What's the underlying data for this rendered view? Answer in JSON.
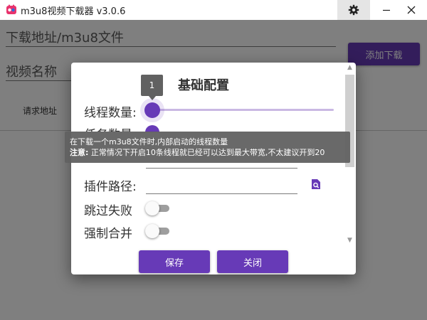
{
  "window": {
    "title": "m3u8视频下载器 v3.0.6",
    "icons": {
      "app": "app-logo-icon",
      "settings": "gear-icon",
      "minimize": "minimize-icon",
      "close": "close-icon"
    }
  },
  "main": {
    "url_placeholder": "下载地址/m3u8文件",
    "name_placeholder": "视频名称",
    "add_button": "添加下载",
    "tab_request": "请求地址"
  },
  "dialog": {
    "title": "基础配置",
    "threads_label": "线程数量:",
    "threads_value": "1",
    "tasks_label": "任务数量:",
    "plugin_label": "插件路径:",
    "skip_label": "跳过失败",
    "merge_label": "强制合并",
    "save_button": "保存",
    "close_button": "关闭",
    "plugin_icon": "file-search-icon",
    "skip_enabled": false,
    "merge_enabled": false
  },
  "tooltip": {
    "line1": "在下载一个m3u8文件时,内部启动的线程数量",
    "line2_prefix": "注意:",
    "line2_text": " 正常情况下开启10条线程就已经可以达到最大带宽,不太建议开到20"
  },
  "colors": {
    "accent": "#673ab7",
    "tooltip_bg": "#616161"
  }
}
